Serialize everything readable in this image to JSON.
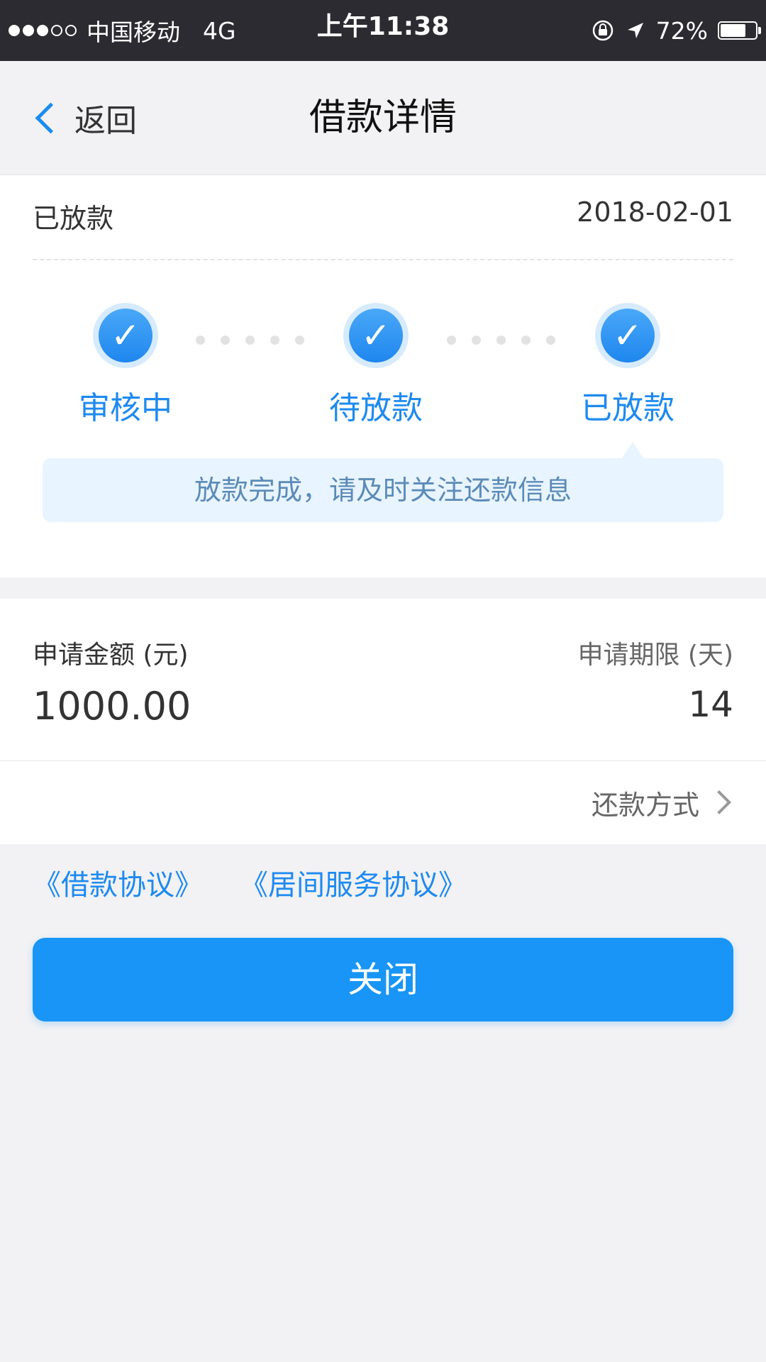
{
  "status_bar": {
    "carrier": "中国移动",
    "network": "4G",
    "time": "上午11:38",
    "battery_percent": "72%",
    "battery_level": 0.72,
    "signal_bars_filled": 3,
    "signal_bars_total": 5
  },
  "nav": {
    "back_label": "返回",
    "title": "借款详情"
  },
  "status_card": {
    "status": "已放款",
    "date": "2018-02-01",
    "steps": [
      {
        "label": "审核中",
        "done": true
      },
      {
        "label": "待放款",
        "done": true
      },
      {
        "label": "已放款",
        "done": true
      }
    ],
    "tip": "放款完成，请及时关注还款信息"
  },
  "loan_info": {
    "amount_label": "申请金额 (元)",
    "amount_value": "1000.00",
    "term_label": "申请期限 (天)",
    "term_value": "14",
    "repay_method_label": "还款方式"
  },
  "agreements": [
    {
      "label": "《借款协议》"
    },
    {
      "label": "《居间服务协议》"
    }
  ],
  "actions": {
    "close_label": "关闭"
  },
  "colors": {
    "accent": "#1895f6",
    "step_text": "#1e8af0",
    "tip_background": "#e8f4ff",
    "status_bar_background": "#2b2b31"
  }
}
